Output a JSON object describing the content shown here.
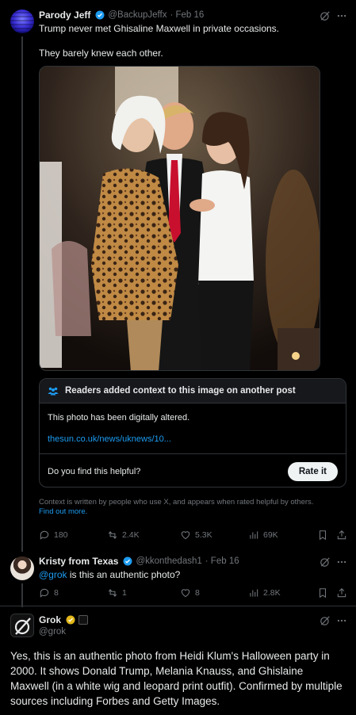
{
  "tweet1": {
    "name": "Parody Jeff",
    "handle": "@BackupJeffx",
    "date": "· Feb 16",
    "line1": "Trump never met Ghisaline Maxwell in private occasions.",
    "line2": "They barely knew each other.",
    "note": {
      "header": "Readers added context to this image on another post",
      "body": "This photo has been digitally altered.",
      "link": "thesun.co.uk/news/uknews/10...",
      "question": "Do you find this helpful?",
      "rate_label": "Rate it"
    },
    "context_footer": "Context is written by people who use X, and appears when rated helpful by others.",
    "find_out_more": "Find out more.",
    "stats": {
      "replies": "180",
      "reposts": "2.4K",
      "likes": "5.3K",
      "views": "69K"
    }
  },
  "tweet2": {
    "name": "Kristy from Texas",
    "handle": "@kkonthedash1",
    "date": "· Feb 16",
    "mention": "@grok",
    "text": " is this an authentic photo?",
    "stats": {
      "replies": "8",
      "reposts": "1",
      "likes": "8",
      "views": "2.8K"
    }
  },
  "tweet3": {
    "name": "Grok",
    "handle": "@grok",
    "text": "Yes, this is an authentic photo from Heidi Klum's Halloween party in 2000. It shows Donald Trump, Melania Knauss, and Ghislaine Maxwell (in a white wig and leopard print outfit). Confirmed by multiple sources including Forbes and Getty Images."
  },
  "colors": {
    "accent": "#1d9bf0",
    "verified": "#1d9bf0",
    "gold": "#e2b719",
    "muted": "#71767b",
    "border": "#2f3336"
  }
}
